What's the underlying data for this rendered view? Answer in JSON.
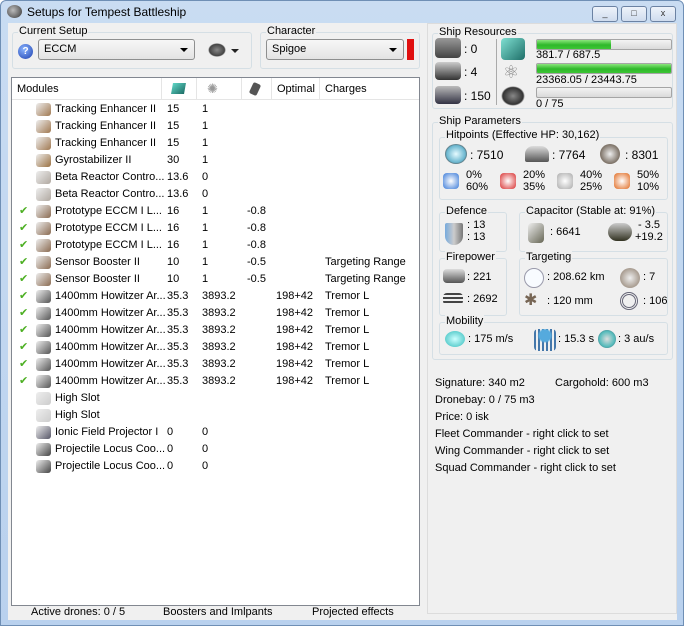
{
  "window": {
    "title": "Setups for Tempest Battleship",
    "min": "_",
    "max": "□",
    "close": "x"
  },
  "setup": {
    "label": "Current Setup",
    "value": "ECCM"
  },
  "character": {
    "label": "Character",
    "value": "Spigoe",
    "status_color": "#e01010"
  },
  "modules": {
    "headers": [
      "Modules",
      "",
      "",
      "",
      "Optimal",
      "Charges"
    ],
    "rows": [
      {
        "check": false,
        "name": "Tracking Enhancer II",
        "c1": "15",
        "c2": "1",
        "c3": "",
        "opt": "",
        "chg": "",
        "icon": "#a07850"
      },
      {
        "check": false,
        "name": "Tracking Enhancer II",
        "c1": "15",
        "c2": "1",
        "c3": "",
        "opt": "",
        "chg": "",
        "icon": "#a07850"
      },
      {
        "check": false,
        "name": "Tracking Enhancer II",
        "c1": "15",
        "c2": "1",
        "c3": "",
        "opt": "",
        "chg": "",
        "icon": "#a07850"
      },
      {
        "check": false,
        "name": "Gyrostabilizer II",
        "c1": "30",
        "c2": "1",
        "c3": "",
        "opt": "",
        "chg": "",
        "icon": "#9a7040"
      },
      {
        "check": false,
        "name": "Beta Reactor Contro...",
        "c1": "13.6",
        "c2": "0",
        "c3": "",
        "opt": "",
        "chg": "",
        "icon": "#b0a8a0"
      },
      {
        "check": false,
        "name": "Beta Reactor Contro...",
        "c1": "13.6",
        "c2": "0",
        "c3": "",
        "opt": "",
        "chg": "",
        "icon": "#b0a8a0"
      },
      {
        "check": true,
        "name": "Prototype ECCM I L...",
        "c1": "16",
        "c2": "1",
        "c3": "-0.8",
        "opt": "",
        "chg": "",
        "icon": "#8a6a50"
      },
      {
        "check": true,
        "name": "Prototype ECCM I L...",
        "c1": "16",
        "c2": "1",
        "c3": "-0.8",
        "opt": "",
        "chg": "",
        "icon": "#8a6a50"
      },
      {
        "check": true,
        "name": "Prototype ECCM I L...",
        "c1": "16",
        "c2": "1",
        "c3": "-0.8",
        "opt": "",
        "chg": "",
        "icon": "#8a6a50"
      },
      {
        "check": true,
        "name": "Sensor Booster II",
        "c1": "10",
        "c2": "1",
        "c3": "-0.5",
        "opt": "",
        "chg": "Targeting Range",
        "icon": "#8a6a50"
      },
      {
        "check": true,
        "name": "Sensor Booster II",
        "c1": "10",
        "c2": "1",
        "c3": "-0.5",
        "opt": "",
        "chg": "Targeting Range",
        "icon": "#8a6a50"
      },
      {
        "check": true,
        "name": "1400mm Howitzer Ar...",
        "c1": "35.3",
        "c2": "3893.2",
        "c3": "",
        "opt": "198+42",
        "chg": "Tremor L",
        "icon": "#555"
      },
      {
        "check": true,
        "name": "1400mm Howitzer Ar...",
        "c1": "35.3",
        "c2": "3893.2",
        "c3": "",
        "opt": "198+42",
        "chg": "Tremor L",
        "icon": "#555"
      },
      {
        "check": true,
        "name": "1400mm Howitzer Ar...",
        "c1": "35.3",
        "c2": "3893.2",
        "c3": "",
        "opt": "198+42",
        "chg": "Tremor L",
        "icon": "#555"
      },
      {
        "check": true,
        "name": "1400mm Howitzer Ar...",
        "c1": "35.3",
        "c2": "3893.2",
        "c3": "",
        "opt": "198+42",
        "chg": "Tremor L",
        "icon": "#555"
      },
      {
        "check": true,
        "name": "1400mm Howitzer Ar...",
        "c1": "35.3",
        "c2": "3893.2",
        "c3": "",
        "opt": "198+42",
        "chg": "Tremor L",
        "icon": "#555"
      },
      {
        "check": true,
        "name": "1400mm Howitzer Ar...",
        "c1": "35.3",
        "c2": "3893.2",
        "c3": "",
        "opt": "198+42",
        "chg": "Tremor L",
        "icon": "#555"
      },
      {
        "check": false,
        "name": "High Slot",
        "c1": "",
        "c2": "",
        "c3": "",
        "opt": "",
        "chg": "",
        "icon": "#ccc"
      },
      {
        "check": false,
        "name": "High Slot",
        "c1": "",
        "c2": "",
        "c3": "",
        "opt": "",
        "chg": "",
        "icon": "#ccc"
      },
      {
        "check": false,
        "name": "Ionic Field Projector I",
        "c1": "0",
        "c2": "0",
        "c3": "",
        "opt": "",
        "chg": "",
        "icon": "#556"
      },
      {
        "check": false,
        "name": "Projectile Locus Coo...",
        "c1": "0",
        "c2": "0",
        "c3": "",
        "opt": "",
        "chg": "",
        "icon": "#444"
      },
      {
        "check": false,
        "name": "Projectile Locus Coo...",
        "c1": "0",
        "c2": "0",
        "c3": "",
        "opt": "",
        "chg": "",
        "icon": "#444"
      }
    ]
  },
  "bottom": {
    "drones": "Active drones: 0 / 5",
    "boosters": "Boosters and Imlpants",
    "projected": "Projected effects"
  },
  "resources": {
    "label": "Ship Resources",
    "turrets": ": 0",
    "launchers": ": 4",
    "calibration": ": 150",
    "cpu": "381.7 / 687.5",
    "cpu_fraction": 0.555,
    "power": "23368.05 / 23443.75",
    "power_fraction": 0.997,
    "drone_bw": "0 / 75",
    "drone_fraction": 0
  },
  "params": {
    "label": "Ship Parameters",
    "hp": {
      "label": "Hitpoints (Effective HP: 30,162)",
      "shield": ": 7510",
      "armor": ": 7764",
      "hull": ": 8301",
      "res": [
        [
          "0%",
          "60%"
        ],
        [
          "20%",
          "35%"
        ],
        [
          "40%",
          "25%"
        ],
        [
          "50%",
          "10%"
        ]
      ]
    },
    "defence": {
      "label": "Defence",
      "a": ": 13",
      "b": ": 13"
    },
    "capacitor": {
      "label": "Capacitor (Stable at: 91%)",
      "amount": ": 6641",
      "minus": "- 3.5",
      "plus": "+19.2"
    },
    "firepower": {
      "label": "Firepower",
      "volley": ": 221",
      "dps": ": 2692"
    },
    "targeting": {
      "label": "Targeting",
      "range": ": 208.62 km",
      "targets": ": 7",
      "scan": ": 120 mm",
      "sensor": ": 106"
    },
    "mobility": {
      "label": "Mobility",
      "speed": ": 175 m/s",
      "align": ": 15.3 s",
      "warp": ": 3 au/s"
    }
  },
  "info": {
    "signature": "Signature: 340 m2",
    "cargo": "Cargohold: 600 m3",
    "dronebay": "Dronebay: 0 / 75 m3",
    "price": "Price: 0 isk",
    "fleet": "Fleet Commander - right click to set",
    "wing": "Wing Commander - right click to set",
    "squad": "Squad Commander - right click to set"
  }
}
